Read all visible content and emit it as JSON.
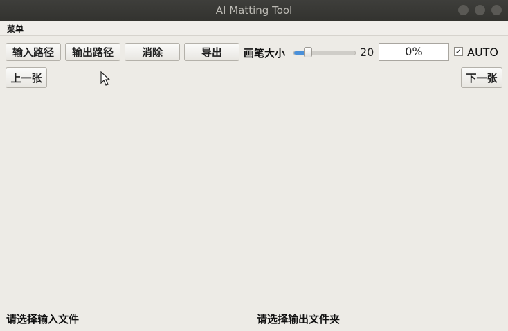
{
  "window": {
    "title": "AI Matting Tool"
  },
  "menu": {
    "items": [
      "菜单"
    ]
  },
  "toolbar": {
    "input_path": "输入路径",
    "output_path": "输出路径",
    "clear": "消除",
    "export": "导出",
    "brush_label": "画笔大小",
    "brush_value": "20",
    "progress": "0%",
    "auto_label": "AUTO",
    "auto_checked": true
  },
  "nav": {
    "prev": "上一张",
    "next": "下一张"
  },
  "status": {
    "input_prompt": "请选择输入文件",
    "output_prompt": "请选择输出文件夹"
  }
}
